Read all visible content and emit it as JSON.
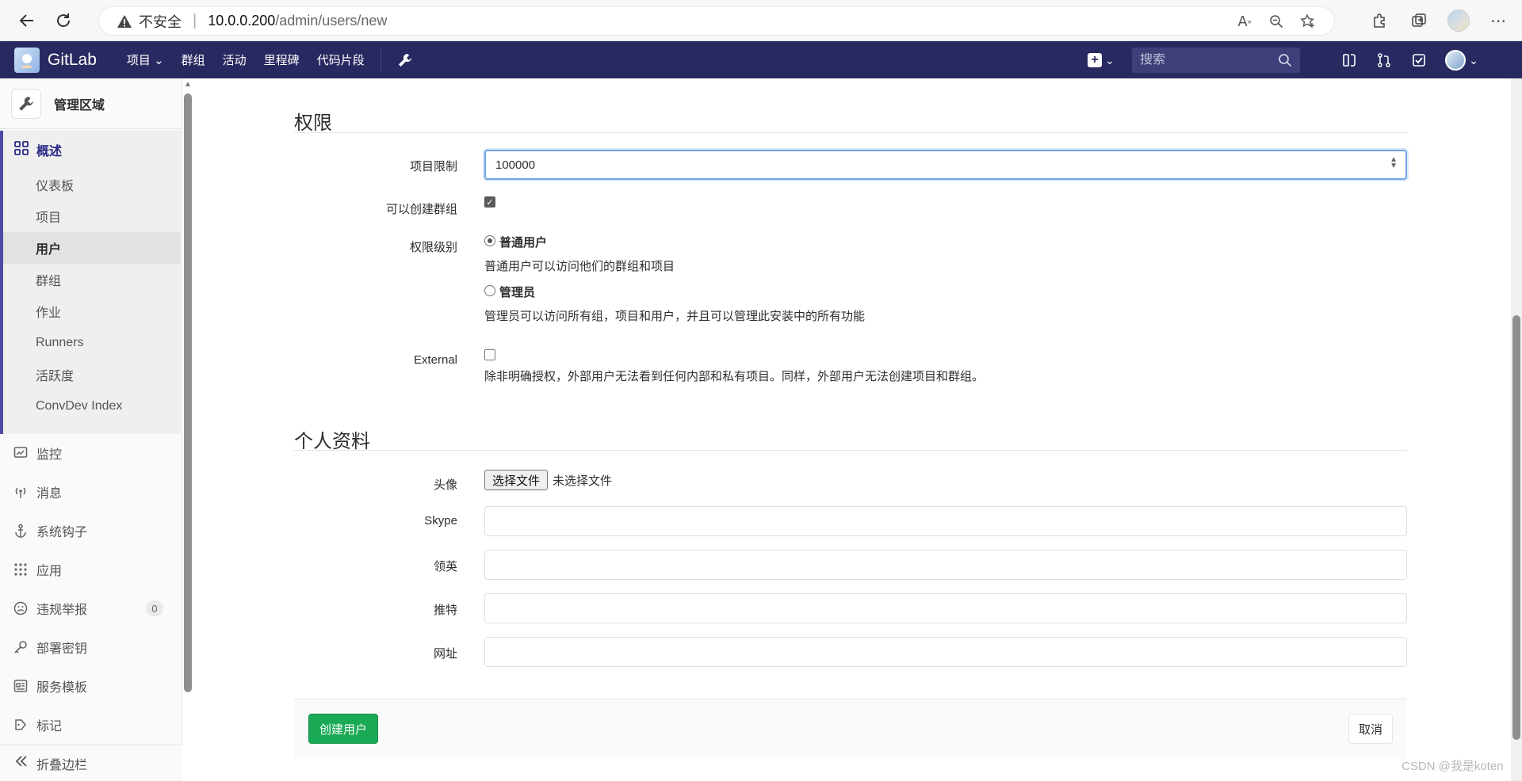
{
  "browser": {
    "insecure_label": "不安全",
    "url_host": "10.0.0.200",
    "url_path": "/admin/users/new"
  },
  "navbar": {
    "brand": "GitLab",
    "links": [
      "项目",
      "群组",
      "活动",
      "里程碑",
      "代码片段"
    ],
    "search_placeholder": "搜索"
  },
  "sidebar": {
    "header_title": "管理区域",
    "overview_label": "概述",
    "overview_items": [
      "仪表板",
      "项目",
      "用户",
      "群组",
      "作业",
      "Runners",
      "活跃度",
      "ConvDev Index"
    ],
    "items": [
      {
        "label": "监控",
        "icon": "monitor-icon"
      },
      {
        "label": "消息",
        "icon": "broadcast-icon"
      },
      {
        "label": "系统钩子",
        "icon": "anchor-icon"
      },
      {
        "label": "应用",
        "icon": "apps-icon"
      },
      {
        "label": "违规举报",
        "icon": "abuse-icon",
        "badge": "0"
      },
      {
        "label": "部署密钥",
        "icon": "key-icon"
      },
      {
        "label": "服务模板",
        "icon": "template-icon"
      },
      {
        "label": "标记",
        "icon": "label-icon"
      }
    ],
    "collapse_label": "折叠边栏"
  },
  "permissions": {
    "title": "权限",
    "projects_limit_label": "项目限制",
    "projects_limit_value": "100000",
    "can_create_group_label": "可以创建群组",
    "access_level_label": "权限级别",
    "regular_title": "普通用户",
    "regular_help": "普通用户可以访问他们的群组和项目",
    "admin_title": "管理员",
    "admin_help": "管理员可以访问所有组，项目和用户，并且可以管理此安装中的所有功能",
    "external_label": "External",
    "external_help": "除非明确授权，外部用户无法看到任何内部和私有项目。同样，外部用户无法创建项目和群组。"
  },
  "profile": {
    "title": "个人资料",
    "avatar_label": "头像",
    "choose_file": "选择文件",
    "no_file": "未选择文件",
    "skype_label": "Skype",
    "linkedin_label": "领英",
    "twitter_label": "推特",
    "website_label": "网址"
  },
  "actions": {
    "create_label": "创建用户",
    "cancel_label": "取消"
  },
  "watermark": "CSDN @我是koten"
}
